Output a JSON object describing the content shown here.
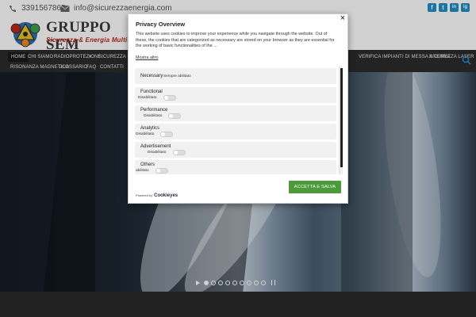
{
  "contact": {
    "phone": "3391567865",
    "email": "info@sicurezzaenergia.com"
  },
  "social": [
    "f",
    "t",
    "in",
    "ig"
  ],
  "logo": {
    "title": "GRUPPO SEM",
    "subtitle": "Sicurezza & Energia Multiservice"
  },
  "nav": {
    "items": [
      "Home",
      "Chi siamo",
      "Radioprotezione",
      "Sicurezza sul la",
      "Verifica impianti di messa a terra",
      "Sicurezza laser",
      "Risonanza magnetica",
      "Glossario",
      "FAQ",
      "Contatti"
    ]
  },
  "slider": {
    "dot_count": 9,
    "active_dot": 0
  },
  "cookie": {
    "title": "Privacy Overview",
    "text": "This website uses cookies to improve your experience while you navigate through the website. Out of these, the cookies that are categorized as necessary are stored on your browser as they are essential for the working of basic functionalities of the ...",
    "more": "Mostra altro",
    "categories": [
      {
        "name": "Necessary",
        "state": "Sempre abilitato"
      },
      {
        "name": "Functional",
        "state": "Disabilitato"
      },
      {
        "name": "Performance",
        "state": "Disabilitato"
      },
      {
        "name": "Analytics",
        "state": "Disabilitato"
      },
      {
        "name": "Advertisement",
        "state": "Disabilitato"
      },
      {
        "name": "Others",
        "state": "abilitato"
      }
    ],
    "accept": "ACCETTA E SALVA",
    "powered_by": "Powered by",
    "brand": "Cookieyes",
    "close": "×"
  },
  "colors": {
    "accent": "#1f8fc9",
    "nav_bg": "#2b2b2b",
    "accept_bg": "#4c9a3c",
    "logo_sub": "#c0281d"
  }
}
